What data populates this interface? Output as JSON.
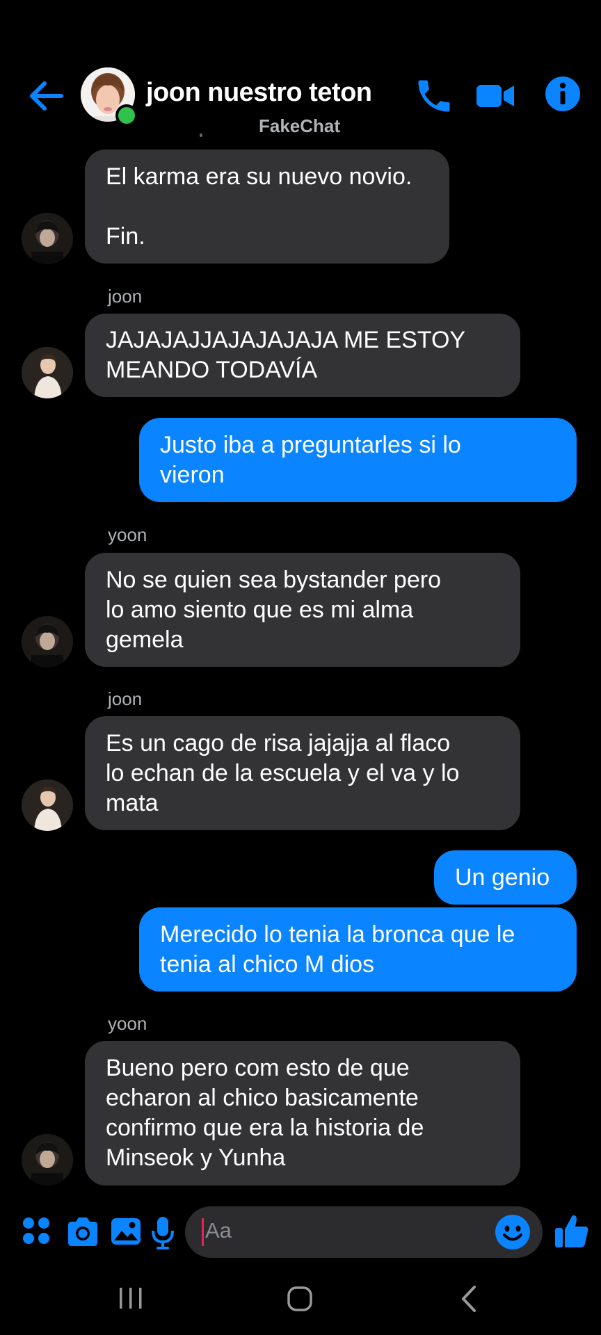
{
  "header": {
    "title": "joon nuestro teton",
    "subtitle": "FakeChat",
    "accent_color": "#0a84ff",
    "icons": [
      "back-arrow-icon",
      "phone-icon",
      "video-camera-icon",
      "info-icon"
    ]
  },
  "messages": [
    {
      "type": "received",
      "sender": "",
      "avatar": "yoon",
      "text": "El karma era su nuevo novio.\n\nFin."
    },
    {
      "type": "received",
      "sender": "joon",
      "avatar": "joon",
      "text": "JAJAJAJJAJAJAJAJA ME ESTOY\nMEANDO TODAVÍA"
    },
    {
      "type": "sent",
      "text": "Justo iba a preguntarles si lo\nvieron"
    },
    {
      "type": "received",
      "sender": "yoon",
      "avatar": "yoon",
      "text": "No se quien sea bystander pero\nlo amo siento que es mi alma\ngemela"
    },
    {
      "type": "received",
      "sender": "joon",
      "avatar": "joon",
      "text": "Es un cago de risa jajajja al flaco\nlo echan de la escuela y el va y lo\nmata"
    },
    {
      "type": "sent",
      "text": "Un genio"
    },
    {
      "type": "sent",
      "text": "Merecido lo tenia la bronca que le\ntenia al chico M dios"
    },
    {
      "type": "received",
      "sender": "yoon",
      "avatar": "yoon",
      "text": "Bueno pero com esto de que\necharon al chico basicamente\nconfirmo que era la historia de\nMinseok y Yunha"
    }
  ],
  "composer": {
    "placeholder": "Aa",
    "icons": [
      "menu-grid-icon",
      "camera-icon",
      "gallery-icon",
      "microphone-icon",
      "emoji-icon",
      "thumbs-up-icon"
    ]
  },
  "system_nav": [
    "recents-icon",
    "home-icon",
    "back-icon"
  ]
}
